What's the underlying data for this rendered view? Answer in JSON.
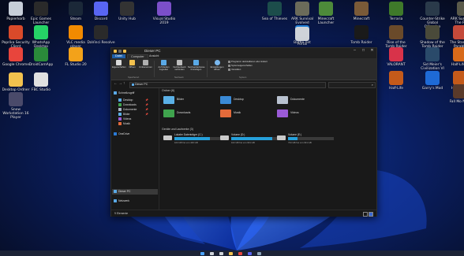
{
  "desktop": {
    "icons": [
      {
        "label": "Papierkorb",
        "color": "#c7ced9"
      },
      {
        "label": "Epic Games Launcher",
        "color": "#2a2a2a"
      },
      {
        "label": "Steam",
        "color": "#1b2838"
      },
      {
        "label": "Discord",
        "color": "#5865f2"
      },
      {
        "label": "Unity Hub",
        "color": "#333333"
      },
      {
        "label": "Visual Studio 2019",
        "color": "#7b4fc9"
      },
      {
        "label": "Sea of Thieves",
        "color": "#1c4d4b"
      },
      {
        "label": "ARK Survival Evolved",
        "color": "#6b6b5a"
      },
      {
        "label": "Minecraft Launcher",
        "color": "#4d8a3a"
      },
      {
        "label": "Minecraft",
        "color": "#7a5a38"
      },
      {
        "label": "Terraria",
        "color": "#3f7a2a"
      },
      {
        "label": "Counter-Strike Global Offensive",
        "color": "#2a3a4a"
      },
      {
        "label": "ARK Survival Of The Fittest",
        "color": "#5a5a4a"
      },
      {
        "label": "Paprika Security Client",
        "color": "#d94a2a"
      },
      {
        "label": "WhatsApp Desktop",
        "color": "#25d366"
      },
      {
        "label": "VLC media player",
        "color": "#f28a00"
      },
      {
        "label": "DaVinci Resolve",
        "color": "#2a2a2a"
      },
      {
        "label": "Battle.net",
        "color": "#1e7ed6"
      },
      {
        "label": "Portal",
        "color": "#cfd3d9"
      },
      {
        "label": "Tomb Raider",
        "color": "#1a1a1a"
      },
      {
        "label": "Rise of the Tomb Raider",
        "color": "#6a4a2a"
      },
      {
        "label": "Shadow of the Tomb Raider",
        "color": "#4a4a3a"
      },
      {
        "label": "The Stanley Parable",
        "color": "#c44a3a"
      },
      {
        "label": "Google Chrome",
        "color": "#e8453c"
      },
      {
        "label": "DroidCamApp",
        "color": "#2a8a3a"
      },
      {
        "label": "FL Studio 20",
        "color": "#f3a21a"
      },
      {
        "label": "VALORANT",
        "color": "#d8334a"
      },
      {
        "label": "Sid Meier's Civilization VI",
        "color": "#2a4a6a"
      },
      {
        "label": "Half-Life 2",
        "color": "#d86a1a"
      },
      {
        "label": "Desktop Ordner",
        "color": "#f2c14e"
      },
      {
        "label": "FBC Studio",
        "color": "#e0e0e0"
      },
      {
        "label": "Half-Life",
        "color": "#c45a1a"
      },
      {
        "label": "Garry's Mod",
        "color": "#1e6ad6"
      },
      {
        "label": "Half-Life 1",
        "color": "#c45a1a"
      },
      {
        "label": "Snow Workstation 16 Player",
        "color": "#4a4a6a"
      },
      {
        "label": "Fall Mo Nuts",
        "color": "#5a3a2a"
      }
    ]
  },
  "window": {
    "title": "Dieser PC",
    "controls": {
      "minimize": "–",
      "maximize": "□",
      "close": "✕"
    },
    "tabs": [
      {
        "label": "Datei"
      },
      {
        "label": "Computer"
      },
      {
        "label": "Ansicht"
      }
    ],
    "ribbon": {
      "buttons": [
        {
          "label": "Eigenschaften",
          "icon": "properties-icon",
          "color": "#d9d9d9"
        },
        {
          "label": "Öffnen",
          "icon": "open-icon",
          "color": "#f2c14e"
        },
        {
          "label": "Umbenennen",
          "icon": "rename-icon",
          "color": "#b0b0b0"
        },
        {
          "label": "Auf Medien zugreifen",
          "icon": "media-icon",
          "color": "#5aa9e6"
        },
        {
          "label": "Netzlaufwerk verbinden",
          "icon": "network-drive-icon",
          "color": "#bdbdbd"
        },
        {
          "label": "Netzwerkadresse hinzufügen",
          "icon": "network-location-icon",
          "color": "#5aa9e6"
        },
        {
          "label": "Einstellungen öffnen",
          "icon": "settings-gear-icon",
          "color": "#7ab8ee"
        }
      ],
      "system_items": [
        "Programm deinstallieren oder ändern",
        "Systemeigenschaften",
        "Verwalten"
      ],
      "groups": [
        "Speicherort",
        "Netzwerk",
        "System"
      ]
    },
    "address": {
      "path": "Dieser PC",
      "search_placeholder": ""
    },
    "navpane": {
      "items": [
        {
          "label": "Schnellzugriff",
          "color": "#5aa9e6",
          "pinned": false
        },
        {
          "label": "Desktop",
          "color": "#5aa9e6",
          "pinned": true
        },
        {
          "label": "Downloads",
          "color": "#3fa34d",
          "pinned": true
        },
        {
          "label": "Dokumente",
          "color": "#a8b3c4",
          "pinned": true
        },
        {
          "label": "Bilder",
          "color": "#5ab0e6",
          "pinned": true
        },
        {
          "label": "Videos",
          "color": "#9a5ad6",
          "pinned": false
        },
        {
          "label": "Musik",
          "color": "#e36a3a",
          "pinned": false
        },
        {
          "label": "OneDrive",
          "color": "#2a7ad6",
          "pinned": false
        },
        {
          "label": "Dieser PC",
          "color": "#5aa9e6",
          "pinned": false
        },
        {
          "label": "Netzwerk",
          "color": "#5aa9e6",
          "pinned": false
        }
      ],
      "pin_glyph": "📌"
    },
    "sections": {
      "folders_title": "Ordner (6)",
      "drives_title": "Geräte und Laufwerke (3)"
    },
    "folders": [
      {
        "label": "Bilder",
        "color": "#5ab0e6"
      },
      {
        "label": "Desktop",
        "color": "#3a8ad6"
      },
      {
        "label": "Dokumente",
        "color": "#b9c2d0"
      },
      {
        "label": "Downloads",
        "color": "#3fa34d"
      },
      {
        "label": "Musik",
        "color": "#e36a3a"
      },
      {
        "label": "Videos",
        "color": "#9a5ad6"
      }
    ],
    "drives": [
      {
        "label": "Lokaler Datenträger (C:)",
        "free": "103 GB frei von 446 GB",
        "used_fraction": 0.77
      },
      {
        "label": "Volume (D:)",
        "free": "102 GB frei von 931 GB",
        "used_fraction": 0.89
      },
      {
        "label": "Volume (E:)",
        "free": "733 GB frei von 931 GB",
        "used_fraction": 0.21
      }
    ],
    "status": {
      "item_count": "9 Elemente"
    }
  },
  "taskbar": {
    "icons": [
      {
        "name": "start-icon",
        "color": "#4aa3ff"
      },
      {
        "name": "search-icon",
        "color": "#cfd3d9"
      },
      {
        "name": "taskview-icon",
        "color": "#cfd3d9"
      },
      {
        "name": "explorer-icon",
        "color": "#f2c14e"
      },
      {
        "name": "chrome-icon",
        "color": "#e8453c"
      },
      {
        "name": "discord-icon",
        "color": "#5865f2"
      },
      {
        "name": "steam-icon",
        "color": "#8aa1b8"
      }
    ]
  }
}
